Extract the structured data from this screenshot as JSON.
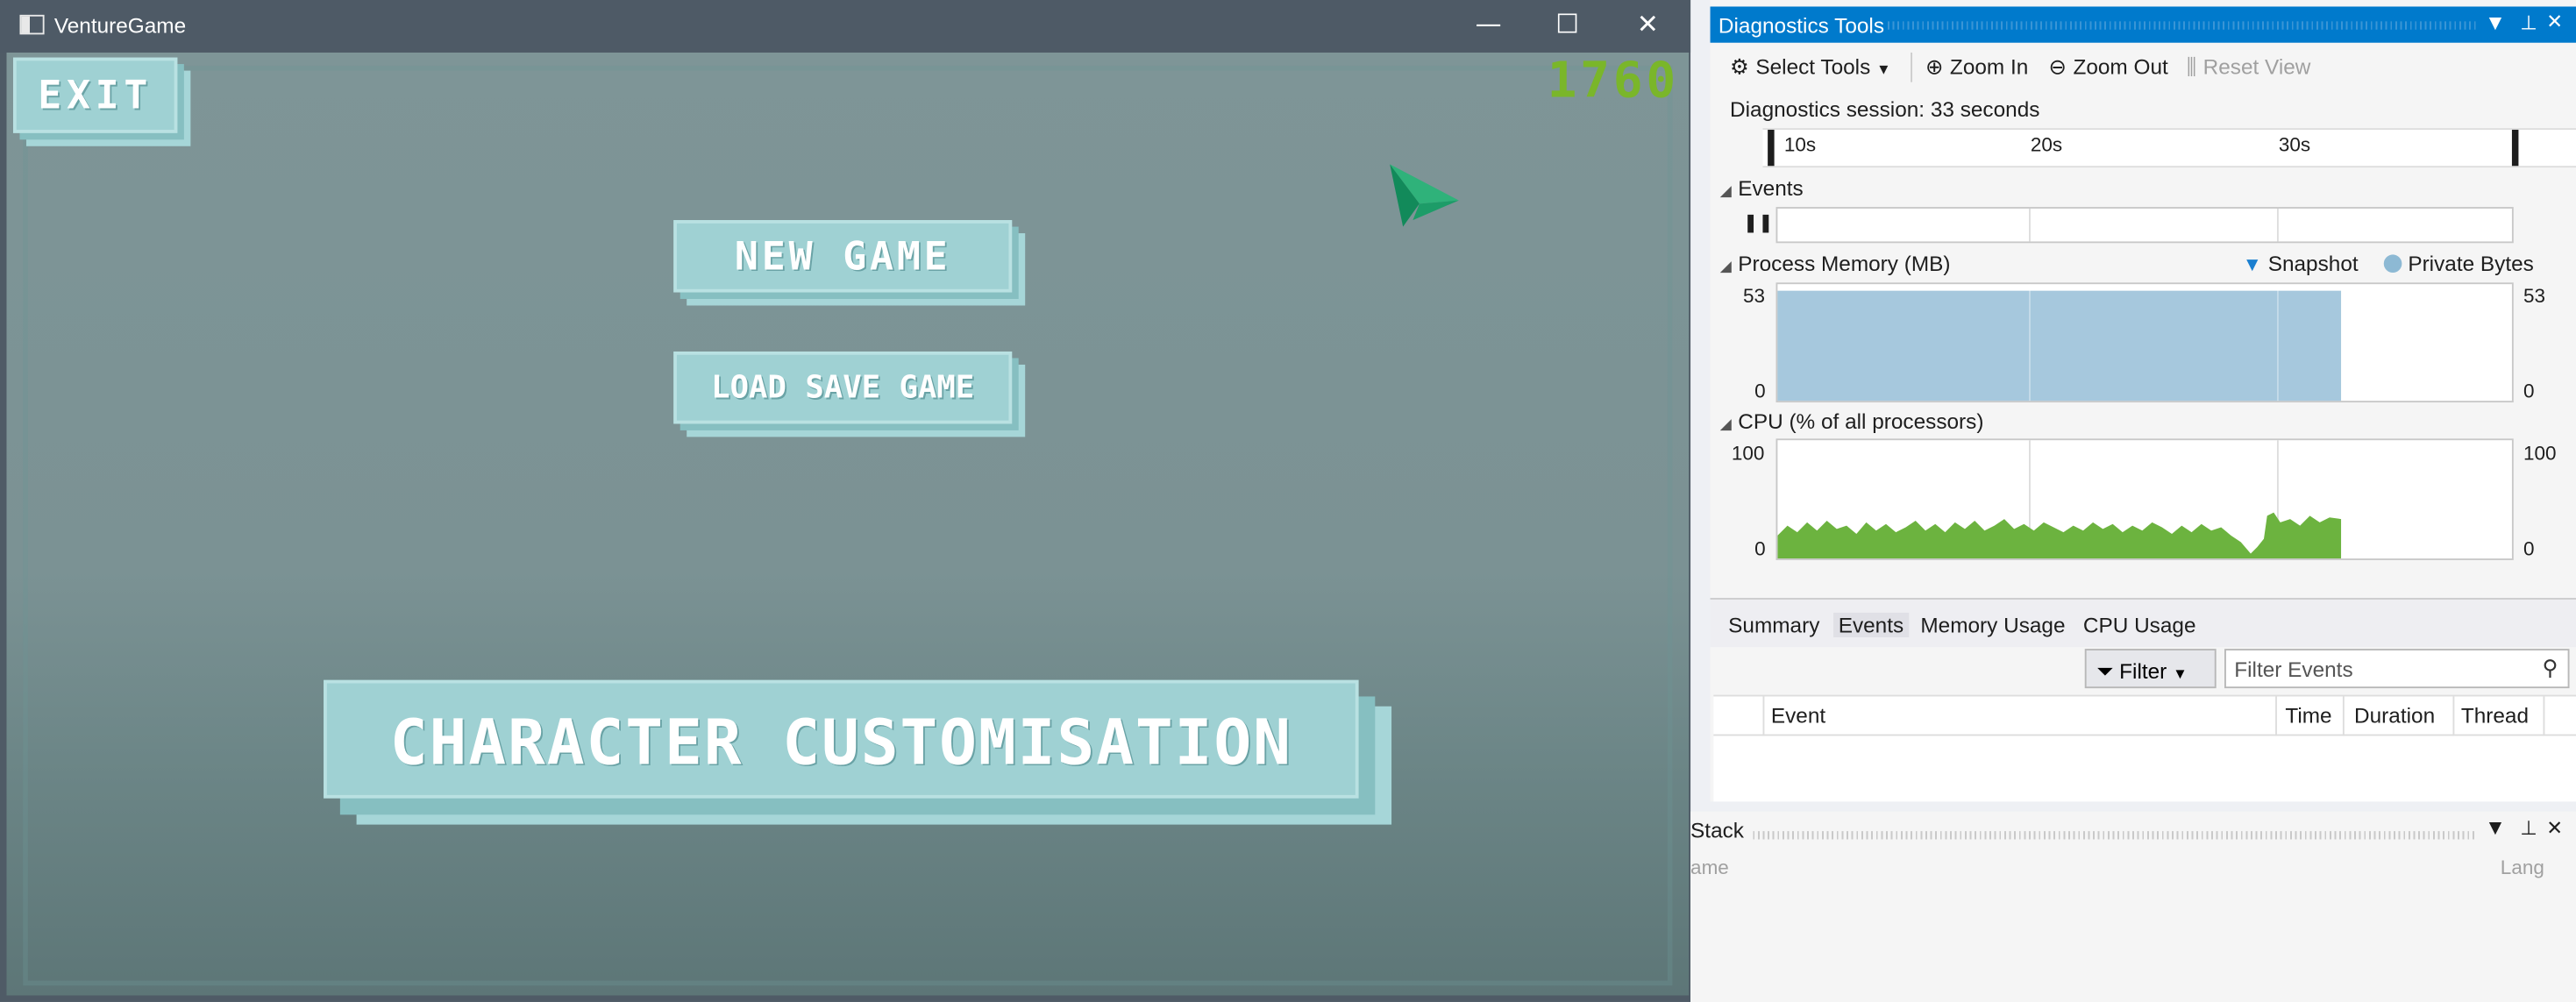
{
  "game_window": {
    "title": "VentureGame",
    "controls": {
      "minimize": "—",
      "maximize": "☐",
      "close": "✕"
    },
    "score": "1760",
    "buttons": {
      "exit": "Exit",
      "new_game": "New Game",
      "load_save_game": "Load Save Game",
      "character_customisation": "Character Customisation"
    },
    "cursor_icon": "paper-plane-cursor-icon"
  },
  "diagnostic_tools": {
    "title": "Diagnostics Tools",
    "pane_controls": {
      "dropdown": "▼",
      "pin": "📌",
      "close": "✕"
    },
    "toolbar": {
      "select_tools": "Select Tools",
      "zoom_in": "Zoom In",
      "zoom_out": "Zoom Out",
      "reset_view": "Reset View"
    },
    "session_text": "Diagnostics session: 33 seconds",
    "ruler_ticks": [
      "10s",
      "20s",
      "30s"
    ],
    "events_section": "Events",
    "memory_section": "Process Memory (MB)",
    "memory_axis": {
      "max": "53",
      "min": "0"
    },
    "legend": {
      "snapshot": "Snapshot",
      "private_bytes": "Private Bytes"
    },
    "cpu_section": "CPU (% of all processors)",
    "cpu_axis": {
      "max": "100",
      "min": "0"
    },
    "tabs": [
      "Summary",
      "Events",
      "Memory Usage",
      "CPU Usage"
    ],
    "active_tab": "Events",
    "filter_label": "Filter",
    "filter_placeholder": "Filter Events",
    "table_columns": [
      "Event",
      "Time",
      "Duration",
      "Thread"
    ],
    "colors": {
      "accent": "#007acc",
      "memory_fill": "#a6c8dd",
      "cpu_fill": "#6cb33f",
      "score": "#7ab62a"
    }
  },
  "stack_pane": {
    "title": "Stack",
    "col_name": "ame",
    "col_lang": "Lang"
  }
}
